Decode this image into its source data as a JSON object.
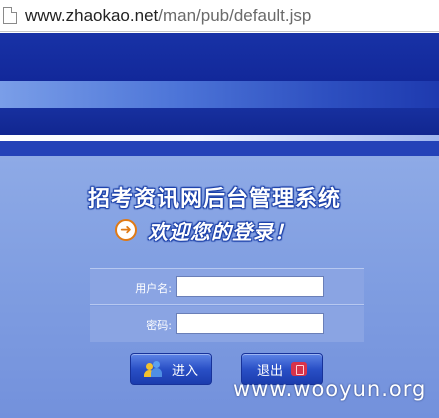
{
  "browser": {
    "url_host": "www.zhaokao.net",
    "url_path": "/man/pub/default.jsp"
  },
  "header": {
    "system_title": "招考资讯网后台管理系统",
    "welcome_text": "欢迎您的登录！"
  },
  "login_form": {
    "username_label": "用户名:",
    "username_value": "",
    "password_label": "密码:",
    "password_value": ""
  },
  "buttons": {
    "enter_label": "进入",
    "exit_label": "退出"
  },
  "watermark": "www.wooyun.org",
  "icons": [
    "page-icon",
    "arrow-right-circle-icon",
    "users-icon",
    "exit-door-icon"
  ],
  "colors": {
    "header_blue": "#1832a6",
    "panel_blue": "#8eaae6",
    "accent_orange": "#e07a15"
  }
}
